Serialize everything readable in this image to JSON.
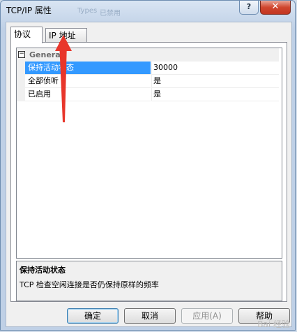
{
  "window": {
    "title": "TCP/IP 属性",
    "title_ghost_1": "Types",
    "title_ghost_2": "已禁用",
    "help_label": "?",
    "close_label": "✕"
  },
  "tabs": [
    {
      "label": "协议",
      "active": true
    },
    {
      "label": "IP 地址",
      "active": false
    }
  ],
  "property_grid": {
    "category": {
      "label": "General",
      "expander": "⊟"
    },
    "rows": [
      {
        "name": "保持活动状态",
        "value": "30000",
        "selected": true
      },
      {
        "name": "全部侦听",
        "value": "是",
        "selected": false
      },
      {
        "name": "已启用",
        "value": "是",
        "selected": false
      }
    ]
  },
  "description": {
    "title": "保持活动状态",
    "text": "TCP 检查空闲连接是否仍保持原样的频率"
  },
  "buttons": {
    "ok": "确定",
    "cancel": "取消",
    "apply": "应用(A)",
    "help": "帮助"
  },
  "annotation": {
    "color": "#e8362b",
    "icon": "red-arrow-up"
  },
  "watermark": "Bai 经验"
}
